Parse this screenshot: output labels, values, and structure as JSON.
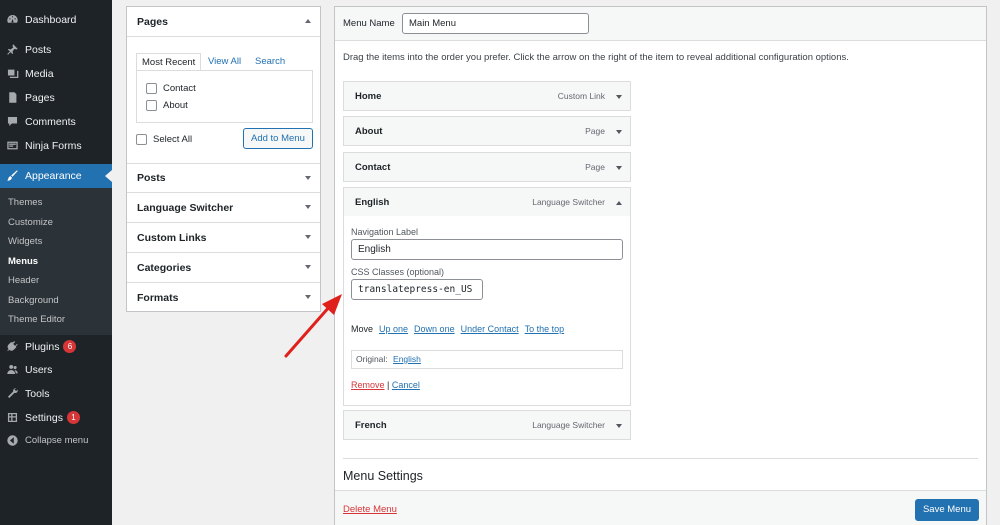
{
  "sidebar": {
    "items": [
      {
        "label": "Dashboard",
        "icon": "dashboard-icon"
      },
      {
        "label": "Posts",
        "icon": "pin-icon"
      },
      {
        "label": "Media",
        "icon": "media-icon"
      },
      {
        "label": "Pages",
        "icon": "pages-icon"
      },
      {
        "label": "Comments",
        "icon": "comment-icon"
      },
      {
        "label": "Ninja Forms",
        "icon": "form-icon"
      },
      {
        "label": "Appearance",
        "icon": "brush-icon"
      },
      {
        "label": "Plugins",
        "icon": "plugin-icon",
        "badge": "6"
      },
      {
        "label": "Users",
        "icon": "users-icon"
      },
      {
        "label": "Tools",
        "icon": "wrench-icon"
      },
      {
        "label": "Settings",
        "icon": "settings-icon",
        "badge": "1"
      },
      {
        "label": "Collapse menu",
        "icon": "collapse-icon"
      }
    ],
    "submenu": [
      "Themes",
      "Customize",
      "Widgets",
      "Menus",
      "Header",
      "Background",
      "Theme Editor"
    ],
    "current_submenu": "Menus"
  },
  "add_items": {
    "pages_title": "Pages",
    "tabs": [
      "Most Recent",
      "View All",
      "Search"
    ],
    "page_options": [
      "Contact",
      "About"
    ],
    "select_all": "Select All",
    "add_button": "Add to Menu",
    "sections": [
      "Posts",
      "Language Switcher",
      "Custom Links",
      "Categories",
      "Formats"
    ]
  },
  "menu": {
    "name_label": "Menu Name",
    "name_value": "Main Menu",
    "instructions": "Drag the items into the order you prefer. Click the arrow on the right of the item to reveal additional configuration options.",
    "items": [
      {
        "title": "Home",
        "type": "Custom Link"
      },
      {
        "title": "About",
        "type": "Page"
      },
      {
        "title": "Contact",
        "type": "Page"
      },
      {
        "title": "English",
        "type": "Language Switcher"
      },
      {
        "title": "French",
        "type": "Language Switcher"
      }
    ],
    "expanded": {
      "nav_label_label": "Navigation Label",
      "nav_label_value": "English",
      "css_label": "CSS Classes (optional)",
      "css_value": "translatepress-en_US",
      "move_label": "Move",
      "move_links": [
        "Up one",
        "Down one",
        "Under Contact",
        "To the top"
      ],
      "original_label": "Original:",
      "original_link": "English",
      "remove": "Remove",
      "separator": "|",
      "cancel": "Cancel"
    },
    "settings_title": "Menu Settings",
    "delete_menu": "Delete Menu",
    "save_button": "Save Menu"
  },
  "colors": {
    "admin_bar": "#1d2327",
    "accent": "#2271b1",
    "badge": "#d63638",
    "annotation_arrow": "#e0201b"
  }
}
